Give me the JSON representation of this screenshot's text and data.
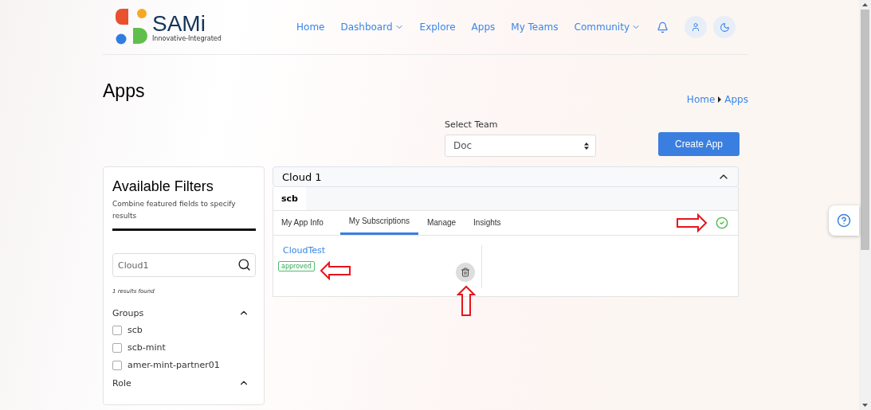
{
  "header": {
    "logo": {
      "name": "SAMi",
      "tagline": "Innovative-Integrated"
    },
    "nav": [
      {
        "label": "Home",
        "dropdown": false
      },
      {
        "label": "Dashboard",
        "dropdown": true
      },
      {
        "label": "Explore",
        "dropdown": false
      },
      {
        "label": "Apps",
        "dropdown": false
      },
      {
        "label": "My Teams",
        "dropdown": false
      },
      {
        "label": "Community",
        "dropdown": true
      }
    ]
  },
  "page": {
    "title": "Apps",
    "breadcrumb": [
      "Home",
      "Apps"
    ]
  },
  "team_select": {
    "label": "Select Team",
    "value": "Doc"
  },
  "create_button": "Create App",
  "filters": {
    "title": "Available Filters",
    "subtitle": "Combine featured fields to specify results",
    "search": {
      "value": "Cloud1"
    },
    "results": "1 results found",
    "sections": [
      {
        "title": "Groups",
        "expanded": true,
        "options": [
          {
            "label": "scb",
            "checked": false
          },
          {
            "label": "scb-mint",
            "checked": false
          },
          {
            "label": "amer-mint-partner01",
            "checked": false
          }
        ]
      },
      {
        "title": "Role",
        "expanded": true
      }
    ]
  },
  "app": {
    "title": "Cloud 1",
    "expanded": true,
    "group": "scb",
    "tabs": [
      {
        "label": "My App Info",
        "selected": false
      },
      {
        "label": "My Subscriptions",
        "selected": true
      },
      {
        "label": "Manage",
        "selected": false
      },
      {
        "label": "Insights",
        "selected": false
      }
    ],
    "subscriptions": [
      {
        "name": "CloudTest",
        "status": "approved"
      }
    ]
  }
}
